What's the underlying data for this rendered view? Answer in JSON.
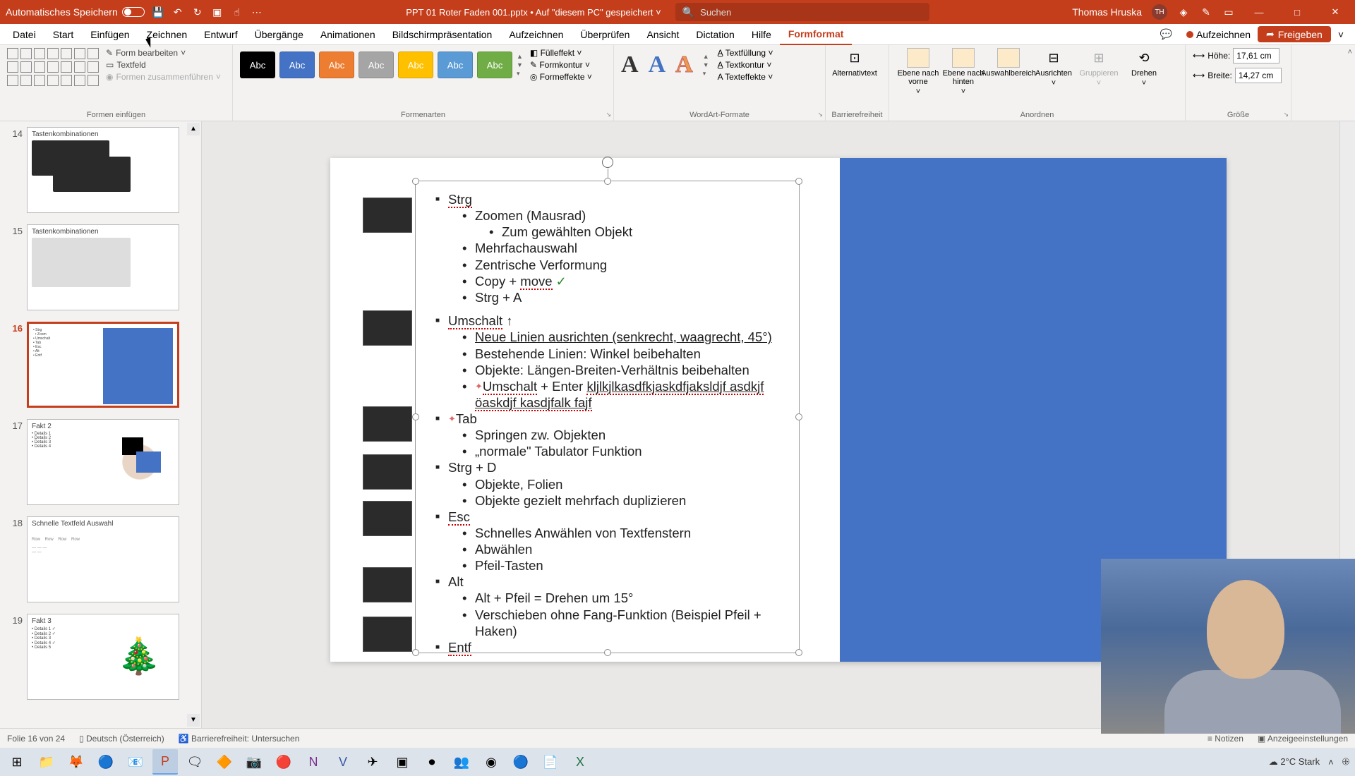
{
  "titlebar": {
    "autosave_label": "Automatisches Speichern",
    "doc_title": "PPT 01 Roter Faden 001.pptx • Auf \"diesem PC\" gespeichert ˅",
    "search_placeholder": "Suchen",
    "user_name": "Thomas Hruska",
    "user_initials": "TH"
  },
  "tabs": {
    "datei": "Datei",
    "start": "Start",
    "einfuegen": "Einfügen",
    "zeichnen": "Zeichnen",
    "entwurf": "Entwurf",
    "uebergaenge": "Übergänge",
    "animationen": "Animationen",
    "praesentation": "Bildschirmpräsentation",
    "aufzeichnen": "Aufzeichnen",
    "ueberpruefen": "Überprüfen",
    "ansicht": "Ansicht",
    "dictation": "Dictation",
    "hilfe": "Hilfe",
    "formformat": "Formformat",
    "record_btn": "Aufzeichnen",
    "share_btn": "Freigeben"
  },
  "ribbon": {
    "formen_einfuegen": "Formen einfügen",
    "form_bearbeiten": "Form bearbeiten",
    "textfeld": "Textfeld",
    "formen_zusammen": "Formen zusammenführen",
    "formenarten": "Formenarten",
    "abc": "Abc",
    "fuelleffekt": "Fülleffekt",
    "formkontur": "Formkontur",
    "formeffekte": "Formeffekte",
    "wordart": "WordArt-Formate",
    "textfuellung": "Textfüllung",
    "textkontur": "Textkontur",
    "texteffekte": "Texteffekte",
    "alternativtext": "Alternativtext",
    "barrierefreiheit": "Barrierefreiheit",
    "ebene_vorne": "Ebene nach vorne",
    "ebene_hinten": "Ebene nach hinten",
    "auswahlbereich": "Auswahlbereich",
    "ausrichten": "Ausrichten",
    "gruppieren": "Gruppieren",
    "drehen": "Drehen",
    "anordnen": "Anordnen",
    "hoehe": "Höhe:",
    "breite": "Breite:",
    "hoehe_val": "17,61 cm",
    "breite_val": "14,27 cm",
    "groesse": "Größe"
  },
  "thumbs": [
    {
      "num": "14",
      "title": "Tastenkombinationen",
      "type": "kbd-dark"
    },
    {
      "num": "15",
      "title": "Tastenkombinationen",
      "type": "kbd-light"
    },
    {
      "num": "16",
      "title": "",
      "type": "current",
      "selected": true
    },
    {
      "num": "17",
      "title": "Fakt 2",
      "type": "fakt2"
    },
    {
      "num": "18",
      "title": "Schnelle Textfeld Auswahl",
      "type": "textfeld"
    },
    {
      "num": "19",
      "title": "Fakt 3",
      "type": "fakt3"
    }
  ],
  "slide": {
    "l1_strg": "Strg",
    "l2_zoom": "Zoomen (Mausrad)",
    "l3_zum": "Zum gewählten Objekt",
    "l2_mehrfach": "Mehrfachauswahl",
    "l2_zentrisch": "Zentrische Verformung",
    "l2_copymove_a": "Copy + ",
    "l2_copymove_b": "move",
    "l2_strga": "Strg + A",
    "l1_umschalt": "Umschalt",
    "l2_neue_a": "Neue Linien ausrichten (senkrecht, waagrecht, 45°)",
    "l2_bestehend": "Bestehende Linien: Winkel beibehalten",
    "l2_objekte_lb": "Objekte: Längen-Breiten-Verhältnis beibehalten",
    "l2_umenter_a": "Umschalt",
    "l2_umenter_b": " + Enter ",
    "l2_umenter_c": "kljlkjlkasdfkjaskdfjaksldjf asdkjf öaskdjf kasdjfalk fajf",
    "l1_tab": "Tab",
    "l2_springen": "Springen zw. Objekten",
    "l2_normale": "„normale\" Tabulator Funktion",
    "l1_strgd": "Strg + D",
    "l2_obj_folien": "Objekte, Folien",
    "l2_duplizieren": "Objekte gezielt mehrfach duplizieren",
    "l1_esc": "Esc",
    "l2_schnelles": "Schnelles Anwählen von Textfenstern",
    "l2_abwaehlen": "Abwählen",
    "l2_pfeil": "Pfeil-Tasten",
    "l1_alt": "Alt",
    "l2_altpfeil": "Alt + Pfeil = Drehen um 15°",
    "l2_verschieben": "Verschieben ohne Fang-Funktion (Beispiel Pfeil + Haken)",
    "l1_entf": "Entf"
  },
  "status": {
    "slide_count": "Folie 16 von 24",
    "lang": "Deutsch (Österreich)",
    "access": "Barrierefreiheit: Untersuchen",
    "notizen": "Notizen",
    "anzeige": "Anzeigeeinstellungen"
  },
  "tray": {
    "weather": "2°C  Stark"
  },
  "colors": {
    "accent": "#c43e1c",
    "slide_blue": "#4472c4",
    "styles": [
      "#000000",
      "#4472c4",
      "#ed7d31",
      "#a5a5a5",
      "#ffc000",
      "#5b9bd5",
      "#70ad47"
    ]
  }
}
